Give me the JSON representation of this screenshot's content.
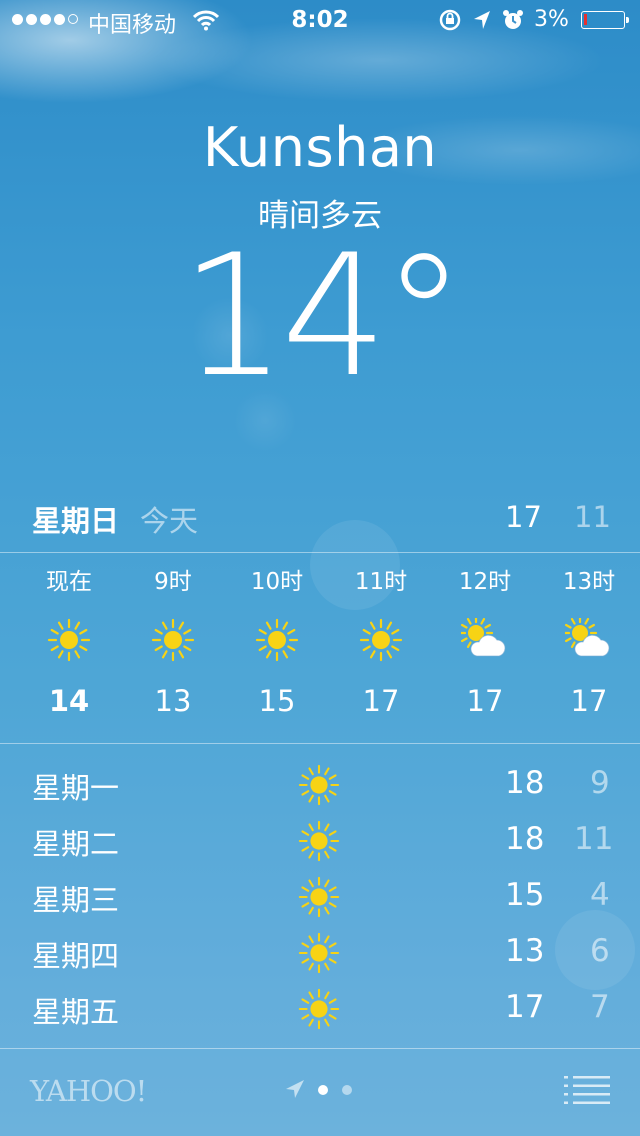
{
  "status_bar": {
    "carrier": "中国移动",
    "time": "8:02",
    "battery_percent": "3%",
    "signal_bars_filled": 4,
    "signal_bars_total": 5,
    "battery_level": 0.03,
    "battery_color": "#e53030"
  },
  "location": {
    "city": "Kunshan",
    "condition": "晴间多云",
    "temperature": "14°"
  },
  "today": {
    "day": "星期日",
    "label": "今天",
    "high": "17",
    "low": "11"
  },
  "hourly": [
    {
      "label": "现在",
      "icon": "sun-icon",
      "temp": "14"
    },
    {
      "label": "9时",
      "icon": "sun-icon",
      "temp": "13"
    },
    {
      "label": "10时",
      "icon": "sun-icon",
      "temp": "15"
    },
    {
      "label": "11时",
      "icon": "sun-icon",
      "temp": "17"
    },
    {
      "label": "12时",
      "icon": "partly-cloudy-icon",
      "temp": "17"
    },
    {
      "label": "13时",
      "icon": "partly-cloudy-icon",
      "temp": "17"
    }
  ],
  "daily": [
    {
      "day": "星期一",
      "icon": "sun-icon",
      "high": "18",
      "low": "9"
    },
    {
      "day": "星期二",
      "icon": "sun-icon",
      "high": "18",
      "low": "11"
    },
    {
      "day": "星期三",
      "icon": "sun-icon",
      "high": "15",
      "low": "4"
    },
    {
      "day": "星期四",
      "icon": "sun-icon",
      "high": "13",
      "low": "6"
    },
    {
      "day": "星期五",
      "icon": "sun-icon",
      "high": "17",
      "low": "7"
    }
  ],
  "footer": {
    "provider": "YAHOO!",
    "page_count": 2,
    "current_page": 1
  },
  "colors": {
    "sun": "#f7d315",
    "cloud": "#ffffff"
  }
}
